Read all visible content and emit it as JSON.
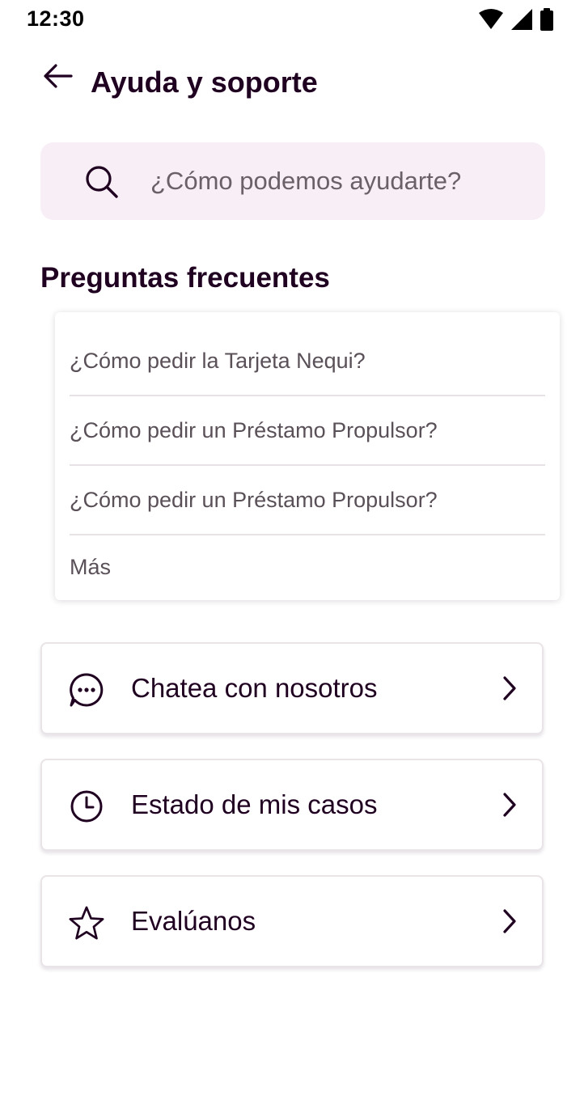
{
  "status_bar": {
    "time": "12:30",
    "icons": [
      "wifi-icon",
      "signal-icon",
      "battery-icon"
    ]
  },
  "header": {
    "back_icon": "arrow-left-icon",
    "title": "Ayuda y soporte"
  },
  "search": {
    "icon": "search-icon",
    "placeholder": "¿Cómo podemos ayudarte?",
    "value": ""
  },
  "faq": {
    "title": "Preguntas frecuentes",
    "items": [
      "¿Cómo pedir la Tarjeta Nequi?",
      "¿Cómo pedir un Préstamo Propulsor?",
      "¿Cómo pedir un Préstamo Propulsor?"
    ],
    "more_label": "Más"
  },
  "actions": [
    {
      "icon": "chat-bubble-icon",
      "label": "Chatea con nosotros"
    },
    {
      "icon": "clock-icon",
      "label": "Estado de mis casos"
    },
    {
      "icon": "star-icon",
      "label": "Evalúanos"
    }
  ],
  "colors": {
    "primary_text": "#200020",
    "secondary_text": "#5a5058",
    "search_background": "#f7eff5",
    "divider": "#e6e2e5"
  }
}
